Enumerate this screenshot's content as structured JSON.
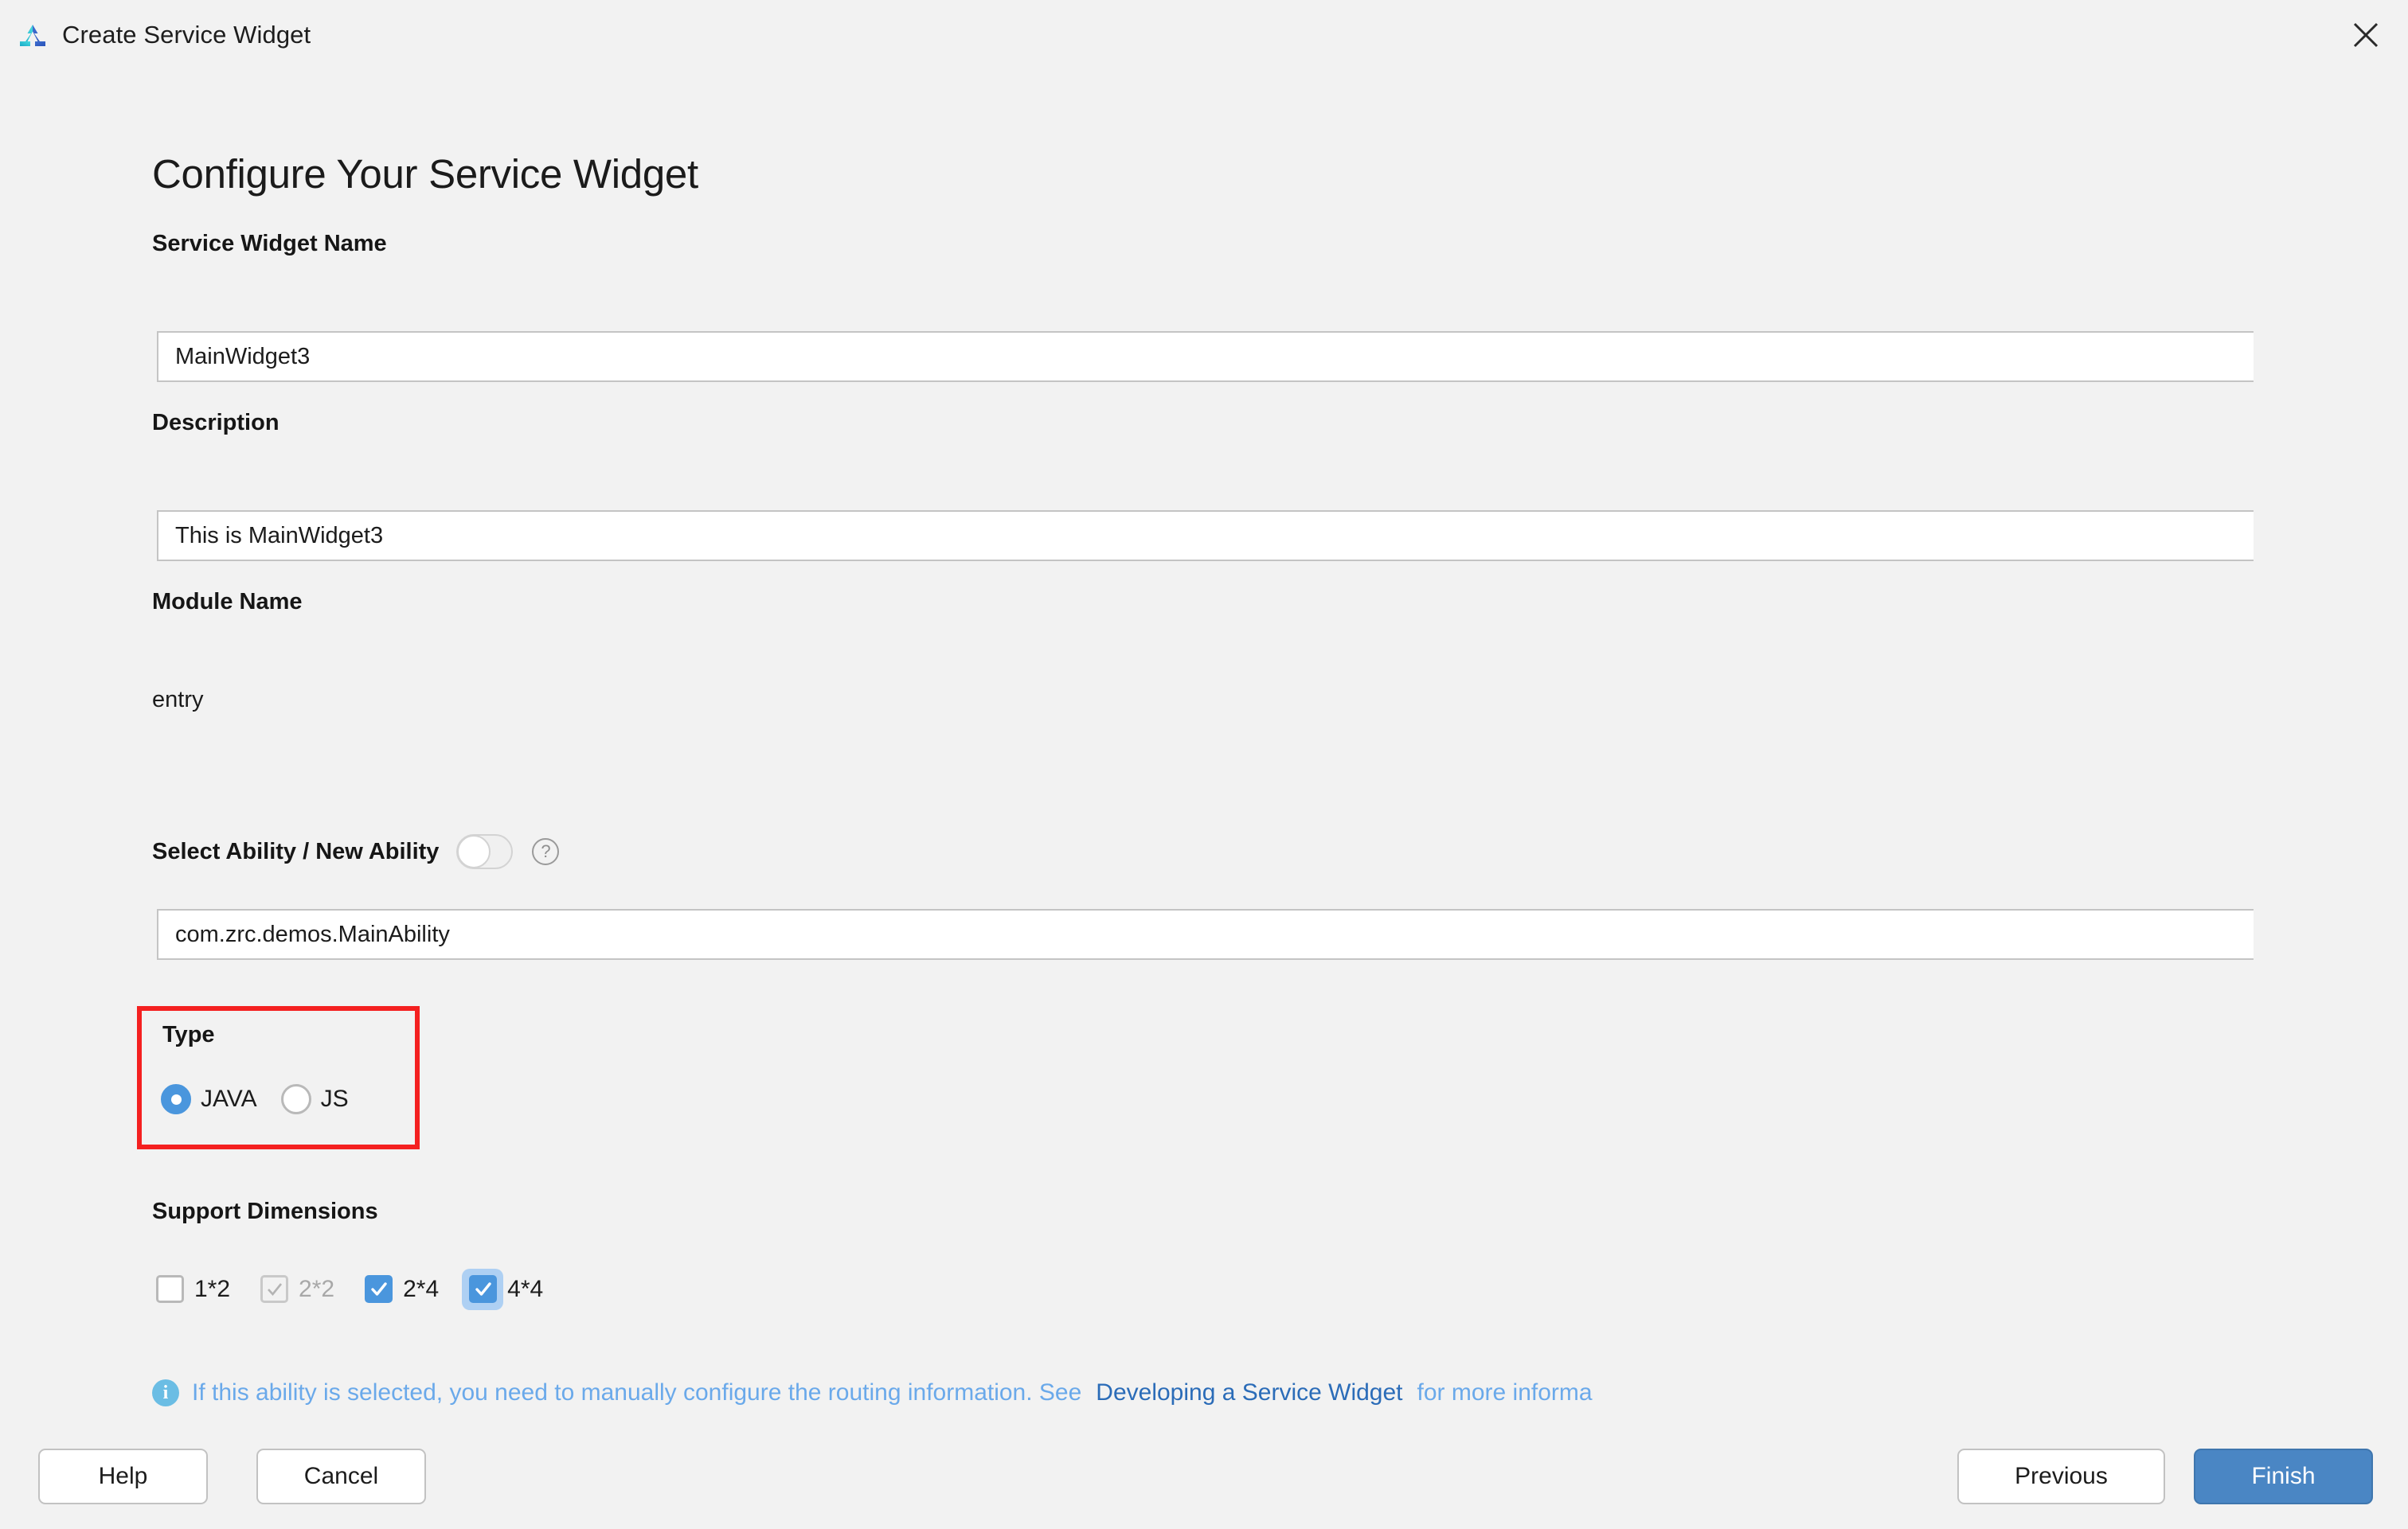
{
  "window": {
    "title": "Create Service Widget",
    "logo_icon": "deveco-triangle-logo",
    "close_icon": "close-icon"
  },
  "page": {
    "heading": "Configure Your Service Widget"
  },
  "form": {
    "widget_name": {
      "label": "Service Widget Name",
      "value": "MainWidget3"
    },
    "description": {
      "label": "Description",
      "value": "This is MainWidget3"
    },
    "module_name": {
      "label": "Module Name",
      "value": "entry"
    },
    "ability": {
      "label": "Select Ability / New Ability",
      "toggle_state": "off",
      "help_icon": "question-mark-icon",
      "value": "com.zrc.demos.MainAbility"
    },
    "type": {
      "label": "Type",
      "highlight_color": "#f42020",
      "selected": "JAVA",
      "options": [
        {
          "label": "JAVA",
          "selected": true
        },
        {
          "label": "JS",
          "selected": false
        }
      ]
    },
    "support_dimensions": {
      "label": "Support Dimensions",
      "options": [
        {
          "label": "1*2",
          "checked": false,
          "disabled": false,
          "focused": false
        },
        {
          "label": "2*2",
          "checked": true,
          "disabled": true,
          "focused": false
        },
        {
          "label": "2*4",
          "checked": true,
          "disabled": false,
          "focused": false
        },
        {
          "label": "4*4",
          "checked": true,
          "disabled": false,
          "focused": true
        }
      ]
    },
    "hint": {
      "icon": "info-icon",
      "text": "If this ability is selected, you need to manually configure the routing information. See",
      "link": "Developing a Service Widget",
      "tail": "for more informa"
    }
  },
  "buttons": {
    "help": "Help",
    "cancel": "Cancel",
    "previous": "Previous",
    "finish": "Finish"
  },
  "colors": {
    "accent": "#4a96dd",
    "primary_button": "#4a86c4",
    "background": "#f2f2f2",
    "hint": "#6aa9ea",
    "link": "#2b6cb8"
  }
}
